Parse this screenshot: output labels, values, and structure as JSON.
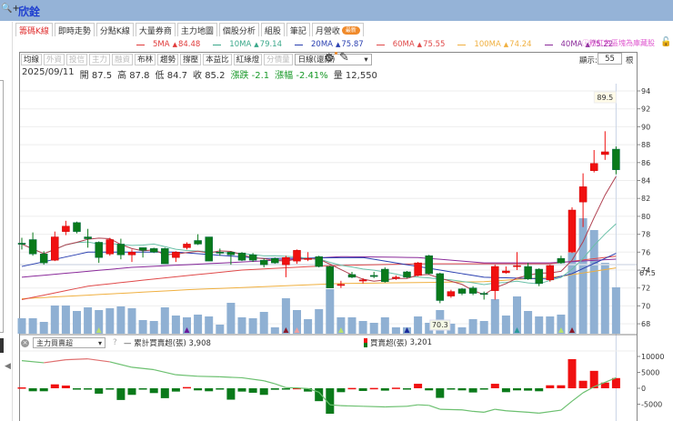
{
  "titlebar": {
    "title": "欣銓",
    "zoom_icon": "🔍+"
  },
  "tabs": [
    {
      "label": "籌碼K線",
      "active": true
    },
    {
      "label": "即時走勢"
    },
    {
      "label": "分點K線"
    },
    {
      "label": "大量券商"
    },
    {
      "label": "主力地圖"
    },
    {
      "label": "個股分析"
    },
    {
      "label": "組股"
    },
    {
      "label": "筆記"
    },
    {
      "label": "月營收",
      "badge": "最新"
    }
  ],
  "ma_legend": [
    {
      "label": "5MA",
      "value": "84.48",
      "color": "#e03a3a"
    },
    {
      "label": "10MA",
      "value": "79.14",
      "color": "#3aa88a"
    },
    {
      "label": "20MA",
      "value": "75.87",
      "color": "#2a3fb0"
    },
    {
      "label": "60MA",
      "value": "75.55",
      "color": "#e04a4a"
    },
    {
      "label": "100MA",
      "value": "74.24",
      "color": "#f0b040"
    },
    {
      "label": "40MA",
      "value": "75.22",
      "color": "#8a2a9a"
    }
  ],
  "ma_note": "ⓘ粉紅色區塊為庫藏股",
  "toolbar": {
    "buttons": [
      {
        "label": "均線"
      },
      {
        "label": "外資",
        "disabled": true
      },
      {
        "label": "投信",
        "disabled": true
      },
      {
        "label": "主力",
        "disabled": true
      },
      {
        "label": "融資",
        "disabled": true
      },
      {
        "label": "布林"
      },
      {
        "label": "趨勢"
      },
      {
        "label": "撐壓"
      },
      {
        "label": "本益比"
      },
      {
        "label": "紅綠燈"
      },
      {
        "label": "分價量",
        "disabled": true
      }
    ],
    "period_select": "日線(還原)",
    "show_label": "顯示:",
    "show_count": "55",
    "show_unit": "根"
  },
  "info": {
    "date": "2025/09/11",
    "open_label": "開",
    "open": "87.5",
    "high_label": "高",
    "high": "87.8",
    "low_label": "低",
    "low": "84.7",
    "close_label": "收",
    "close": "85.2",
    "change_label": "漲跌",
    "change": "-2.1",
    "pct_label": "漲幅",
    "pct": "-2.41%",
    "vol_label": "量",
    "volume": "12,550"
  },
  "sub": {
    "indicator_select": "主力買賣超",
    "help": "?",
    "cum_label": "累計買賣超(張)",
    "cum_value": "3,908",
    "bar_label": "買賣超(張)",
    "bar_value": "3,201"
  },
  "colors": {
    "up": "#f01010",
    "down": "#0a7a1a",
    "volume": "#8fb0d3"
  },
  "chart_data": {
    "type": "candlestick",
    "price_axis": {
      "min": 67,
      "max": 95,
      "ticks": [
        68,
        70,
        72,
        74,
        76,
        78,
        80,
        82,
        84,
        86,
        88,
        90,
        92,
        94
      ]
    },
    "ref_tag": "67.5",
    "high_marker": "89.5",
    "low_marker": "70.3",
    "high_marker_index": 53,
    "low_marker_index": 38,
    "ohlc": [
      [
        77.0,
        77.6,
        76.3,
        76.9
      ],
      [
        77.4,
        78.2,
        75.6,
        75.8
      ],
      [
        75.8,
        76.1,
        74.6,
        74.8
      ],
      [
        75.1,
        78.3,
        75.0,
        77.7
      ],
      [
        78.3,
        79.5,
        77.9,
        78.9
      ],
      [
        79.3,
        79.4,
        78.1,
        78.3
      ],
      [
        77.7,
        78.6,
        76.5,
        77.5
      ],
      [
        77.1,
        77.2,
        74.8,
        75.4
      ],
      [
        75.8,
        77.6,
        75.6,
        77.4
      ],
      [
        76.9,
        77.5,
        75.2,
        75.7
      ],
      [
        75.7,
        76.3,
        74.9,
        76.0
      ],
      [
        76.5,
        76.5,
        75.4,
        76.2
      ],
      [
        76.4,
        76.5,
        75.9,
        76.0
      ],
      [
        76.4,
        76.5,
        74.7,
        74.7
      ],
      [
        75.4,
        76.1,
        74.9,
        76.0
      ],
      [
        76.5,
        77.1,
        76.3,
        76.9
      ],
      [
        77.3,
        78.0,
        76.8,
        76.9
      ],
      [
        77.7,
        77.7,
        75.0,
        75.0
      ],
      [
        76.0,
        76.4,
        75.6,
        75.9
      ],
      [
        76.0,
        76.1,
        74.6,
        75.7
      ],
      [
        75.9,
        76.0,
        75.0,
        75.1
      ],
      [
        75.7,
        75.9,
        74.9,
        75.1
      ],
      [
        75.1,
        75.3,
        74.3,
        74.6
      ],
      [
        75.3,
        75.4,
        74.7,
        74.8
      ],
      [
        74.6,
        75.6,
        73.2,
        75.4
      ],
      [
        75.0,
        76.3,
        74.7,
        76.2
      ],
      [
        75.3,
        76.0,
        75.0,
        75.3
      ],
      [
        75.5,
        75.6,
        74.3,
        74.4
      ],
      [
        74.4,
        74.5,
        72.0,
        72.0
      ],
      [
        72.4,
        72.8,
        72.0,
        72.4
      ],
      [
        73.5,
        73.8,
        73.1,
        73.2
      ],
      [
        72.9,
        73.1,
        72.5,
        72.9
      ],
      [
        73.4,
        73.8,
        73.1,
        73.3
      ],
      [
        74.1,
        74.3,
        72.6,
        72.7
      ],
      [
        73.2,
        73.4,
        72.9,
        73.2
      ],
      [
        73.8,
        73.9,
        73.1,
        73.2
      ],
      [
        73.4,
        74.9,
        73.3,
        74.8
      ],
      [
        75.6,
        75.7,
        73.5,
        73.6
      ],
      [
        73.6,
        73.7,
        70.3,
        70.6
      ],
      [
        71.1,
        71.8,
        70.9,
        71.6
      ],
      [
        71.9,
        72.0,
        71.2,
        71.4
      ],
      [
        72.0,
        72.2,
        71.2,
        71.4
      ],
      [
        71.4,
        71.6,
        70.7,
        71.3
      ],
      [
        71.7,
        74.6,
        70.7,
        74.4
      ],
      [
        73.7,
        74.4,
        73.6,
        73.9
      ],
      [
        74.4,
        76.0,
        74.0,
        74.5
      ],
      [
        74.4,
        74.8,
        72.9,
        73.0
      ],
      [
        74.1,
        74.2,
        72.2,
        72.5
      ],
      [
        72.9,
        74.6,
        72.7,
        74.5
      ],
      [
        75.3,
        75.6,
        74.7,
        74.8
      ],
      [
        76.0,
        81.0,
        75.9,
        80.7
      ],
      [
        81.6,
        84.8,
        78.8,
        83.3
      ],
      [
        85.1,
        87.4,
        84.9,
        85.9
      ],
      [
        86.9,
        89.5,
        86.3,
        87.2
      ],
      [
        87.5,
        87.8,
        84.7,
        85.2
      ]
    ],
    "volume": [
      4180,
      4180,
      3200,
      7630,
      7630,
      6150,
      7130,
      6400,
      6890,
      7380,
      6890,
      3690,
      3440,
      7130,
      4920,
      4430,
      5170,
      4670,
      2460,
      8360,
      4430,
      4180,
      5900,
      1720,
      9590,
      6400,
      3940,
      6640,
      12050,
      4430,
      4430,
      3440,
      2950,
      4430,
      1720,
      1720,
      4670,
      2950,
      6400,
      2710,
      1720,
      3940,
      3440,
      9350,
      4920,
      10090,
      6150,
      4670,
      4670,
      5170,
      21890,
      31240,
      28040,
      19190,
      12550
    ],
    "ma_keypoints": {
      "20MA": [
        [
          0,
          74.4
        ],
        [
          6,
          76.0
        ],
        [
          14,
          76.0
        ],
        [
          22,
          75.3
        ],
        [
          31,
          75.4
        ],
        [
          38,
          74.0
        ],
        [
          42,
          73.2
        ],
        [
          48,
          73.0
        ],
        [
          50,
          73.6
        ],
        [
          54,
          75.87
        ]
      ],
      "40MA": [
        [
          0,
          73.2
        ],
        [
          10,
          74.3
        ],
        [
          20,
          74.9
        ],
        [
          29,
          75.5
        ],
        [
          36,
          75.4
        ],
        [
          42,
          74.8
        ],
        [
          48,
          74.8
        ],
        [
          54,
          75.22
        ]
      ],
      "60MA": [
        [
          0,
          70.7
        ],
        [
          6,
          72.2
        ],
        [
          12,
          73.0
        ],
        [
          20,
          74.0
        ],
        [
          28,
          74.5
        ],
        [
          36,
          74.7
        ],
        [
          48,
          74.7
        ],
        [
          54,
          75.55
        ]
      ],
      "100MA": [
        [
          0,
          70.8
        ],
        [
          15,
          71.8
        ],
        [
          29,
          72.5
        ],
        [
          42,
          72.7
        ],
        [
          49,
          73.3
        ],
        [
          54,
          74.24
        ]
      ]
    },
    "markers": [
      [
        7,
        "#b8e070"
      ],
      [
        15,
        "#6a1a9a"
      ],
      [
        24,
        "#8a1a2a"
      ],
      [
        25,
        "#f0a0a0"
      ],
      [
        29,
        "#b8e070"
      ],
      [
        35,
        "#1a2a9a"
      ],
      [
        45,
        "#2a9a9a"
      ],
      [
        49,
        "#b8e070"
      ],
      [
        50,
        "#8a1a2a"
      ]
    ],
    "sub_axis": {
      "ticks": [
        10000,
        5000,
        0,
        -5000
      ],
      "labels": [
        "10000",
        "5000",
        "0",
        "-5000"
      ]
    },
    "net_buy": [
      280,
      -940,
      -940,
      1230,
      850,
      -100,
      -280,
      -1700,
      -190,
      -3680,
      -2070,
      -100,
      -1510,
      -3110,
      -1040,
      380,
      -660,
      -940,
      -380,
      -3580,
      -1040,
      -1410,
      -2070,
      -470,
      -200,
      100,
      -1040,
      -4050,
      -8000,
      -1230,
      100,
      -850,
      100,
      -750,
      190,
      -50,
      1410,
      -660,
      -3020,
      -100,
      -660,
      -1320,
      -280,
      1410,
      -1230,
      -660,
      -750,
      -940,
      940,
      940,
      9150,
      2360,
      5470,
      1790,
      3201
    ],
    "cumulative": [
      [
        0,
        8680
      ],
      [
        2,
        8010
      ],
      [
        4,
        8960
      ],
      [
        6,
        9240
      ],
      [
        8,
        8300
      ],
      [
        10,
        6600
      ],
      [
        12,
        5850
      ],
      [
        14,
        4240
      ],
      [
        16,
        3770
      ],
      [
        18,
        3600
      ],
      [
        20,
        3300
      ],
      [
        22,
        2360
      ],
      [
        23,
        1410
      ],
      [
        24,
        190
      ],
      [
        25,
        100
      ],
      [
        26,
        -100
      ],
      [
        27,
        -1230
      ],
      [
        28,
        -5190
      ],
      [
        29,
        -5470
      ],
      [
        31,
        -5660
      ],
      [
        33,
        -5850
      ],
      [
        35,
        -5660
      ],
      [
        36,
        -5190
      ],
      [
        37,
        -5380
      ],
      [
        38,
        -6600
      ],
      [
        40,
        -6790
      ],
      [
        41,
        -7260
      ],
      [
        42,
        -7540
      ],
      [
        43,
        -6600
      ],
      [
        44,
        -7070
      ],
      [
        46,
        -7540
      ],
      [
        47,
        -7830
      ],
      [
        49,
        -6880
      ],
      [
        50,
        -4050
      ],
      [
        51,
        -1410
      ],
      [
        52,
        470
      ],
      [
        53,
        1890
      ],
      [
        54,
        3300
      ]
    ],
    "cumulative_red_range": [
      2,
      8
    ]
  }
}
